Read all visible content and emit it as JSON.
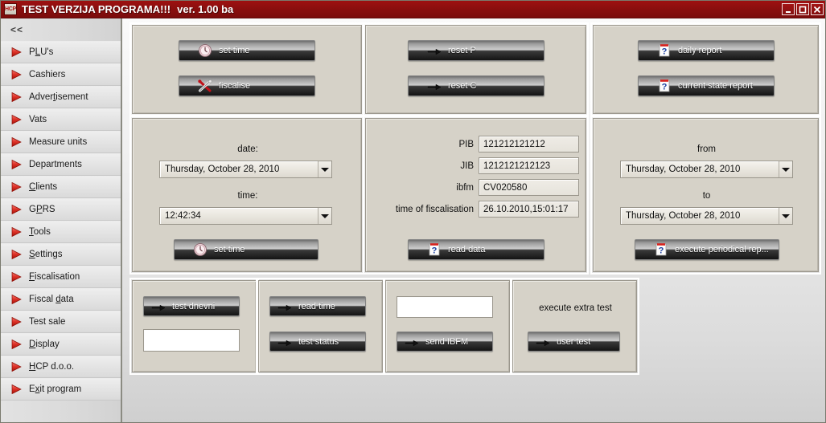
{
  "window": {
    "app_icon_text": "HCP",
    "title": "TEST VERZIJA PROGRAMA!!!",
    "version": "ver. 1.00 ba",
    "minimize_label": "_",
    "maximize_label": "□",
    "close_label": "✕"
  },
  "sidebar": {
    "collapse_label": "<<",
    "items": [
      {
        "label": "PLU's",
        "pre": "P",
        "mnemonic": "L",
        "post": "U's"
      },
      {
        "label": "Cashiers",
        "pre": "Cashiers",
        "mnemonic": "",
        "post": ""
      },
      {
        "label": "Advertisement",
        "pre": "Adver",
        "mnemonic": "t",
        "post": "isement"
      },
      {
        "label": "Vats",
        "pre": "Vats",
        "mnemonic": "",
        "post": ""
      },
      {
        "label": "Measure units",
        "pre": "Measure units",
        "mnemonic": "",
        "post": ""
      },
      {
        "label": "Departments",
        "pre": "Departments",
        "mnemonic": "",
        "post": ""
      },
      {
        "label": "Clients",
        "pre": "",
        "mnemonic": "C",
        "post": "lients"
      },
      {
        "label": "GPRS",
        "pre": "G",
        "mnemonic": "P",
        "post": "RS"
      },
      {
        "label": "Tools",
        "pre": "",
        "mnemonic": "T",
        "post": "ools"
      },
      {
        "label": "Settings",
        "pre": "",
        "mnemonic": "S",
        "post": "ettings"
      },
      {
        "label": "Fiscalisation",
        "pre": "",
        "mnemonic": "F",
        "post": "iscalisation"
      },
      {
        "label": "Fiscal data",
        "pre": "Fiscal ",
        "mnemonic": "d",
        "post": "ata"
      },
      {
        "label": "Test sale",
        "pre": "Test sale",
        "mnemonic": "",
        "post": ""
      },
      {
        "label": "Display",
        "pre": "",
        "mnemonic": "D",
        "post": "isplay"
      },
      {
        "label": "HCP d.o.o.",
        "pre": "",
        "mnemonic": "H",
        "post": "CP d.o.o."
      },
      {
        "label": "Exit program",
        "pre": "E",
        "mnemonic": "x",
        "post": "it program"
      }
    ]
  },
  "panels": {
    "time_actions": {
      "set_time_label": "set time",
      "set_time_icon": "clock-icon",
      "fiscalise_label": "fiscalise",
      "fiscalise_icon": "tools-cross-icon"
    },
    "reset_actions": {
      "reset_p_label": "reset P",
      "reset_p_icon": "arrow-icon",
      "reset_c_label": "reset C",
      "reset_c_icon": "arrow-icon"
    },
    "report_actions": {
      "daily_report_label": "daily report",
      "daily_report_icon": "note-question-icon",
      "current_state_report_label": "current state report",
      "current_state_report_icon": "note-question-icon"
    },
    "datetime": {
      "date_label": "date:",
      "date_value": "Thursday, October 28, 2010",
      "time_label": "time:",
      "time_value": "12:42:34",
      "set_time_label": "set time",
      "set_time_icon": "clock-icon"
    },
    "fiscal_info": {
      "pib_label": "PIB",
      "pib_value": "121212121212",
      "jib_label": "JIB",
      "jib_value": "1212121212123",
      "ibfm_label": "ibfm",
      "ibfm_value": "CV020580",
      "fiscalisation_time_label": "time of fiscalisation",
      "fiscalisation_time_value": "26.10.2010,15:01:17",
      "read_data_label": "read data",
      "read_data_icon": "note-question-icon"
    },
    "periodical": {
      "from_label": "from",
      "from_value": "Thursday, October 28, 2010",
      "to_label": "to",
      "to_value": "Thursday, October 28, 2010",
      "execute_label": "execute periodical rep...",
      "execute_icon": "note-question-icon"
    },
    "test_dnevni": {
      "button_label": "test dnevni",
      "button_icon": "arrow-icon",
      "output_value": ""
    },
    "test_status": {
      "read_time_label": "read time",
      "read_time_icon": "arrow-icon",
      "test_status_label": "test status",
      "test_status_icon": "arrow-icon"
    },
    "send_ibfm": {
      "input_value": "",
      "button_label": "send IBFM",
      "button_icon": "arrow-icon"
    },
    "extra_test": {
      "title": "execute extra test",
      "button_label": "user test",
      "button_icon": "arrow-icon"
    }
  },
  "colors": {
    "titlebar": "#8d0f0f",
    "panel_bg": "#d6d2c8",
    "accent_arrow": "#d8281e",
    "button_dark": "#262626"
  }
}
